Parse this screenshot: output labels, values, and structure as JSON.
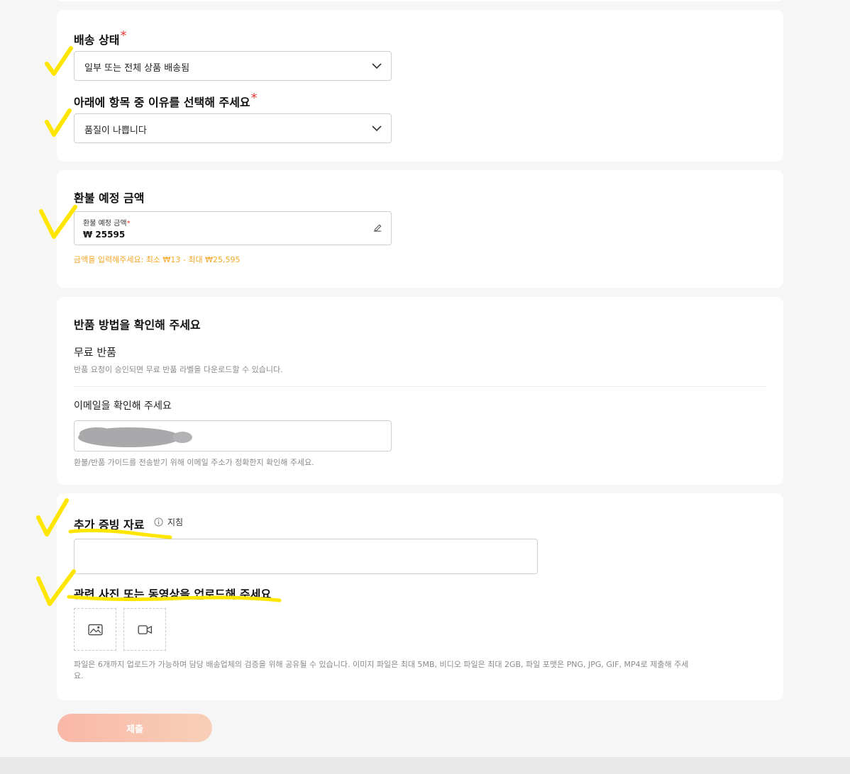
{
  "delivery": {
    "status_label": "배송 상태",
    "status_value": "일부 또는 전체 상품 배송됨",
    "reason_label": "아래에 항목 중 이유를 선택해 주세요",
    "reason_value": "품질이 나쁩니다",
    "required_mark": "*"
  },
  "refund": {
    "section_title": "환불 예정 금액",
    "field_label": "환불 예정 금액",
    "amount": "₩ 25595",
    "hint": "금액을 입력해주세요: 최소 ₩13 - 최대 ₩25,595"
  },
  "return_method": {
    "title": "반품 방법을 확인해 주세요",
    "option_title": "무료 반품",
    "option_desc": "반품 요청이 승인되면 무료 반품 라벨을 다운로드할 수 있습니다.",
    "email_label": "이메일을 확인해 주세요",
    "email_hint": "환불/반품 가이드를 전송받기 위해 이메일 주소가 정확한지 확인해 주세요."
  },
  "evidence": {
    "title": "추가 증빙 자료",
    "guide_label": "지침",
    "upload_title": "관련 사진 또는 동영상을 업로드해 주세요",
    "upload_note_line1": "파일은 6개까지 업로드가 가능하며 담당 배송업체의 검증을 위해 공유될 수 있습니다. 이미지 파일은 최대 5MB, 비디오 파일은 최대 2GB, 파일 포맷은 PNG, JPG, GIF, MP4로 제출해 주세",
    "upload_note_line2": "요."
  },
  "submit_label": "제출",
  "colors": {
    "highlight": "#ffe600",
    "required": "#e53935",
    "hint_orange": "#f5a623",
    "submit_start": "#f9b8a8",
    "submit_end": "#f8cfb8"
  }
}
